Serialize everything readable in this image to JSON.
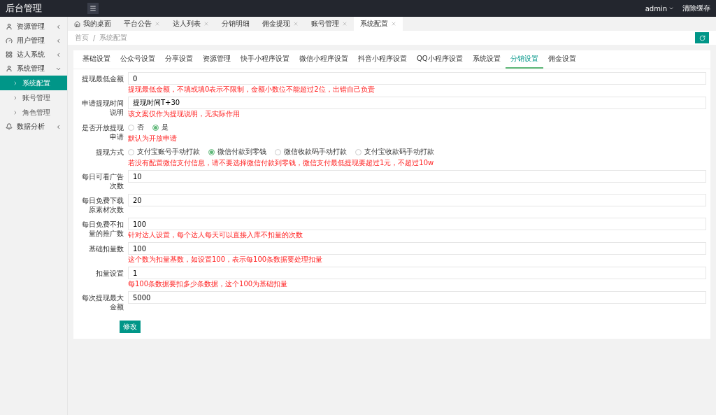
{
  "header": {
    "title": "后台管理",
    "user": "admin",
    "clear_cache": "清除缓存"
  },
  "sidebar": {
    "items": [
      {
        "label": "资源管理",
        "expanded": false
      },
      {
        "label": "用户管理",
        "expanded": false
      },
      {
        "label": "达人系统",
        "expanded": false
      },
      {
        "label": "系统管理",
        "expanded": true,
        "children": [
          {
            "label": "系统配置",
            "selected": true
          },
          {
            "label": "账号管理",
            "selected": false
          },
          {
            "label": "角色管理",
            "selected": false
          }
        ]
      },
      {
        "label": "数据分析",
        "expanded": false
      }
    ]
  },
  "page_tabs": [
    {
      "label": "我的桌面",
      "selected": false
    },
    {
      "label": "平台公告",
      "selected": false
    },
    {
      "label": "达人列表",
      "selected": false
    },
    {
      "label": "分销明细",
      "selected": false
    },
    {
      "label": "佣金提现",
      "selected": false
    },
    {
      "label": "账号管理",
      "selected": false
    },
    {
      "label": "系统配置",
      "selected": true
    }
  ],
  "breadcrumb": {
    "items": [
      "首页",
      "系统配置"
    ],
    "separator": "/"
  },
  "settings_tabs": [
    {
      "label": "基础设置",
      "selected": false
    },
    {
      "label": "公众号设置",
      "selected": false
    },
    {
      "label": "分享设置",
      "selected": false
    },
    {
      "label": "资源管理",
      "selected": false
    },
    {
      "label": "快手小程序设置",
      "selected": false
    },
    {
      "label": "微信小程序设置",
      "selected": false
    },
    {
      "label": "抖音小程序设置",
      "selected": false
    },
    {
      "label": "QQ小程序设置",
      "selected": false
    },
    {
      "label": "系统设置",
      "selected": false
    },
    {
      "label": "分销设置",
      "selected": true
    },
    {
      "label": "佣金设置",
      "selected": false
    }
  ],
  "form": [
    {
      "kind": "text",
      "label": "提现最低金额",
      "value": "0",
      "hint": "提现最低金额，不填或填0表示不限制，金额小数位不能超过2位，出错自己负责"
    },
    {
      "kind": "text",
      "label": "申请提现时间说明",
      "value": "提现时间T+30",
      "hint": "该文案仅作为提现说明，无实际作用"
    },
    {
      "kind": "radio",
      "label": "是否开放提现申请",
      "options": [
        {
          "label": "否",
          "selected": false
        },
        {
          "label": "是",
          "selected": true
        }
      ],
      "hint": "默认为开放申请"
    },
    {
      "kind": "radio",
      "label": "提现方式",
      "options": [
        {
          "label": "支付宝账号手动打款",
          "selected": false
        },
        {
          "label": "微信付款到零钱",
          "selected": true
        },
        {
          "label": "微信收款码手动打款",
          "selected": false
        },
        {
          "label": "支付宝收款码手动打款",
          "selected": false
        }
      ],
      "hint": "若没有配置微信支付信息，请不要选择微信付款到零钱，微信支付最低提现要超过1元，不超过10w"
    },
    {
      "kind": "text",
      "label": "每日可看广告次数",
      "value": "10"
    },
    {
      "kind": "text",
      "label": "每日免费下载原素材次数",
      "value": "20"
    },
    {
      "kind": "text",
      "label": "每日免费不扣量的推广数",
      "value": "100",
      "hint": "针对达人设置，每个达人每天可以直接入库不扣量的次数"
    },
    {
      "kind": "text",
      "label": "基础扣量数",
      "value": "100",
      "hint": "这个数为扣量基数，如设置100，表示每100条数据要处理扣量"
    },
    {
      "kind": "text",
      "label": "扣量设置",
      "value": "1",
      "hint": "每100条数据要扣多少条数据，这个100为基础扣量"
    },
    {
      "kind": "text",
      "label": "每次提现最大金额",
      "value": "5000"
    }
  ],
  "submit": "修改"
}
